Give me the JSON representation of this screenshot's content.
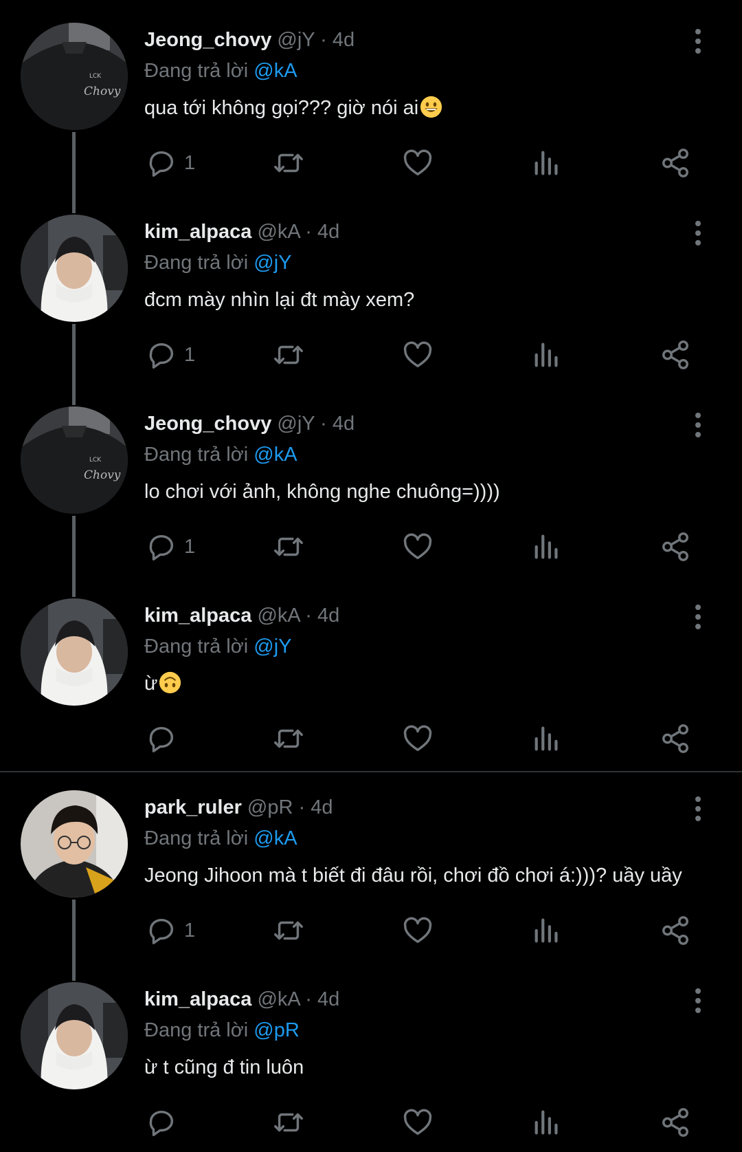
{
  "reply_prefix": "Đang trả lời",
  "colors": {
    "background": "#000000",
    "text": "#e7e9ea",
    "muted": "#71767b",
    "mention": "#1d9bf0"
  },
  "tweets": [
    {
      "name": "Jeong_chovy",
      "handle": "@jY",
      "sep": "·",
      "time": "4d",
      "reply_to": "@kA",
      "text": "qua tới không gọi??? giờ nói ai",
      "emoji": "grinning-face",
      "reply_count": "1",
      "avatar": "chovy-jersey"
    },
    {
      "name": "kim_alpaca",
      "handle": "@kA",
      "sep": "·",
      "time": "4d",
      "reply_to": "@jY",
      "text": "đcm mày nhìn lại đt mày xem?",
      "emoji": "",
      "reply_count": "1",
      "avatar": "white-hood"
    },
    {
      "name": "Jeong_chovy",
      "handle": "@jY",
      "sep": "·",
      "time": "4d",
      "reply_to": "@kA",
      "text": "lo chơi với ảnh, không nghe chuông=))))",
      "emoji": "",
      "reply_count": "1",
      "avatar": "chovy-jersey"
    },
    {
      "name": "kim_alpaca",
      "handle": "@kA",
      "sep": "·",
      "time": "4d",
      "reply_to": "@jY",
      "text": "ừ",
      "emoji": "upside-down-face",
      "reply_count": "",
      "avatar": "white-hood"
    },
    {
      "name": "park_ruler",
      "handle": "@pR",
      "sep": "·",
      "time": "4d",
      "reply_to": "@kA",
      "text": "Jeong Jihoon mà t biết đi đâu rồi, chơi đồ chơi á:)))? uầy uầy",
      "emoji": "",
      "reply_count": "1",
      "avatar": "glasses-boy"
    },
    {
      "name": "kim_alpaca",
      "handle": "@kA",
      "sep": "·",
      "time": "4d",
      "reply_to": "@pR",
      "text": "ừ t cũng đ tin luôn",
      "emoji": "",
      "reply_count": "",
      "avatar": "white-hood"
    }
  ],
  "icons": {
    "reply": "reply-bubble-icon",
    "retweet": "retweet-icon",
    "like": "heart-icon",
    "views": "views-bar-icon",
    "share": "share-icon",
    "more": "more-vertical-icon"
  }
}
